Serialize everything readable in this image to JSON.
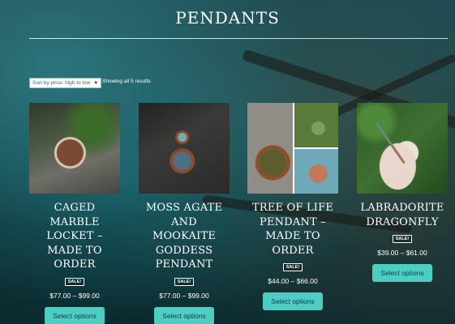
{
  "page": {
    "title": "PENDANTS"
  },
  "toolbar": {
    "sort_selected": "Sort by price: high to low",
    "result_count": "Showing all 5 results"
  },
  "products": [
    {
      "name": "CAGED MARBLE LOCKET – MADE TO ORDER",
      "sale_badge": "SALE!",
      "price_range": "$77.00 – $99.00",
      "button_label": "Select options"
    },
    {
      "name": "MOSS AGATE AND MOOKAITE GODDESS PENDANT",
      "sale_badge": "SALE!",
      "price_range": "$77.00 – $99.00",
      "button_label": "Select options"
    },
    {
      "name": "TREE OF LIFE PENDANT – MADE TO ORDER",
      "sale_badge": "SALE!",
      "price_range": "$44.00 – $66.00",
      "button_label": "Select options"
    },
    {
      "name": "LABRADORITE DRAGONFLY",
      "sale_badge": "SALE!",
      "price_range": "$39.00 – $61.00",
      "button_label": "Select options"
    }
  ],
  "colors": {
    "button_bg": "#4ecdc4",
    "text": "#ffffff"
  }
}
